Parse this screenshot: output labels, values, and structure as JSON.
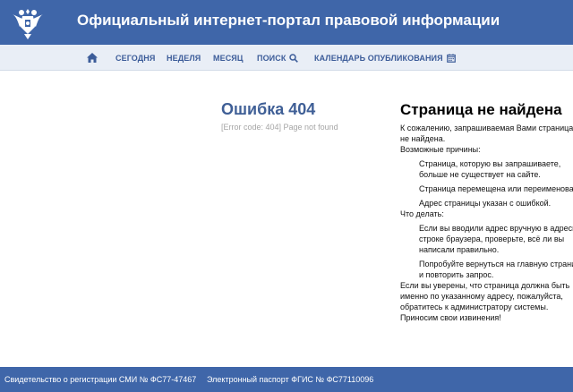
{
  "header": {
    "title": "Официальный интернет-портал правовой информации",
    "emblem_icon": "coat-of-arms-icon"
  },
  "nav": {
    "home_icon": "home-icon",
    "today": "СЕГОДНЯ",
    "week": "НЕДЕЛЯ",
    "month": "МЕСЯЦ",
    "search": "ПОИСК",
    "search_icon": "search-icon",
    "calendar": "КАЛЕНДАРЬ ОПУБЛИКОВАНИЯ",
    "calendar_icon": "calendar-icon"
  },
  "error": {
    "title": "Ошибка 404",
    "code": "[Error code: 404] Page not found"
  },
  "content": {
    "title": "Страница не найдена",
    "intro_1": "К сожалению, запрашиваемая Вами страница",
    "intro_2": "не найдена.",
    "reasons_label": "Возможные причины:",
    "reason1_1": "Страница, которую вы запрашиваете,",
    "reason1_2": "больше не существует на сайте.",
    "reason2": "Страница перемещена или переименована.",
    "reason3": "Адрес страницы указан с ошибкой.",
    "todo_label": "Что делать:",
    "todo1_1": "Если вы вводили адрес вручную в адресной",
    "todo1_2": "строке браузера, проверьте, всё ли вы",
    "todo1_3": "написали правильно.",
    "todo2_1": "Попробуйте вернуться на главную страницу",
    "todo2_2": "и повторить запрос.",
    "outro_1": "Если вы уверены, что страница должна быть",
    "outro_2": "именно по указанному адресу, пожалуйста,",
    "outro_3": "обратитесь к администратору системы.",
    "outro_4": "Приносим свои извинения!"
  },
  "footer": {
    "registration": "Свидетельство о регистрации СМИ № ФС77-47467",
    "passport": "Электронный паспорт ФГИС № ФС77110096"
  },
  "colors": {
    "header_bg": "#3f66a9",
    "nav_bg": "#e9eef6",
    "nav_text": "#3c5c99",
    "error_title": "#3f5f96"
  }
}
